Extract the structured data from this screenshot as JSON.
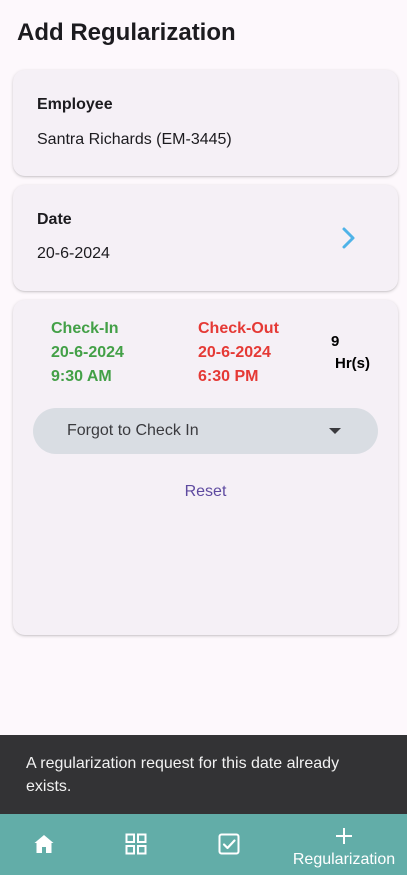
{
  "page": {
    "title": "Add Regularization"
  },
  "employee": {
    "label": "Employee",
    "value": "Santra Richards (EM-3445)"
  },
  "date": {
    "label": "Date",
    "value": "20-6-2024"
  },
  "check_in": {
    "label": "Check-In",
    "date": "20-6-2024",
    "time": "9:30 AM",
    "color": "#43a047"
  },
  "check_out": {
    "label": "Check-Out",
    "date": "20-6-2024",
    "time": "6:30 PM",
    "color": "#e53935"
  },
  "duration": {
    "value": "9",
    "unit": "Hr(s)"
  },
  "reason_dropdown": {
    "selected": "Forgot to Check In"
  },
  "reset_label": "Reset",
  "snackbar": {
    "message": "A regularization request for this date already exists."
  },
  "bottom_nav": {
    "background": "#62ada8",
    "items": [
      {
        "icon": "home-icon"
      },
      {
        "icon": "grid-icon"
      },
      {
        "icon": "checkbox-icon"
      },
      {
        "icon": "plus-icon",
        "label": "Regularization"
      }
    ]
  }
}
